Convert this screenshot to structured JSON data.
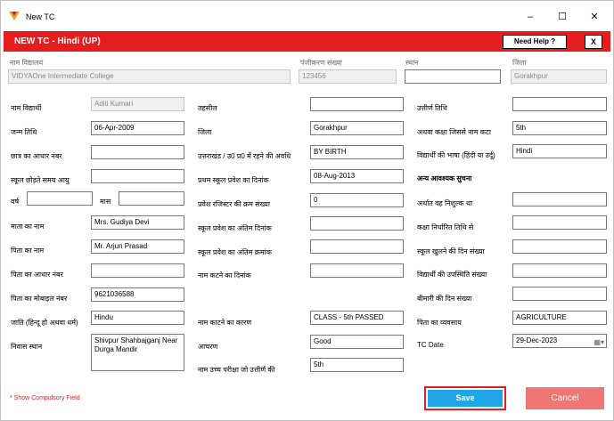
{
  "window": {
    "title": "New TC",
    "min": "–",
    "max": "☐",
    "close": "✕"
  },
  "header": {
    "title": "NEW TC - Hindi (UP)",
    "help": "Need Help ?",
    "close": "X"
  },
  "top": {
    "school_label": "नाम विद्यालय",
    "school_value": "VIDYAOne Intermediate College",
    "reg_label": "पंजीकरण संख्या",
    "reg_value": "123456",
    "place_label": "स्थान",
    "place_value": "",
    "district_label": "जिला",
    "district_value": "Gorakhpur"
  },
  "col1": {
    "student_name_label": "नाम विद्यार्थी",
    "student_name": "Aditi Kumari",
    "dob_label": "जन्म तिथि",
    "dob": "06-Apr-2009",
    "aadhar_label": "छात्र का आधार नंबर",
    "aadhar": "",
    "age_leaving_label": "स्कूल छोड़ते समय आयु",
    "age_leaving": "",
    "year_label": "वर्ष",
    "year": "",
    "month_label": "मास",
    "month": "",
    "mother_label": "माता का नाम",
    "mother": "Mrs. Gudiya Devi",
    "father_label": "पिता का नाम",
    "father": "Mr. Arjun Prasad",
    "father_aadhar_label": "पिता का आधार नंबर",
    "father_aadhar": "",
    "father_mobile_label": "पिता का मोबाइल नंबर",
    "father_mobile": "9621036588",
    "caste_label": "जाति (हिन्दू हो अथवा धर्म)",
    "caste": "Hindu",
    "residence_label": "निवास स्थान",
    "residence": "Shivpur Shahbajganj Near Durga Mandir"
  },
  "col2": {
    "tehsil_label": "तहसील",
    "tehsil": "",
    "district_label": "जिला",
    "district": "Gorakhpur",
    "uttarakhand_label": "उत्तराखंड / उ0 प्र0 में रहने की अवधि",
    "uttarakhand": "BY BIRTH",
    "first_admission_label": "प्रथम स्कूल प्रवेश का दिनांक",
    "first_admission": "08-Aug-2013",
    "admission_reg_label": "प्रवेश रजिस्टर की क्रम संख्या",
    "admission_reg": "0",
    "last_admission_date_label": "स्कूल प्रवेश का अंतिम दिनांक",
    "last_admission_date": "",
    "last_admission_no_label": "स्कूल प्रवेश का अंतिम क्रमांक",
    "last_admission_no": "",
    "removal_date_label": "नाम कटने का दिनांक",
    "removal_date": "",
    "removal_reason_label": "नाम काटने का कारण",
    "removal_reason": "CLASS - 5th PASSED",
    "conduct_label": "आचरण",
    "conduct": "Good",
    "higher_exam_label": "नाम उच्च परीक्षा जो उत्तीर्ण की",
    "higher_exam": "5th"
  },
  "col3": {
    "pass_date_label": "उत्तीर्ण तिथि",
    "pass_date": "",
    "class_label": "अथवा कक्षा जिससे नाम कटा",
    "class": "5th",
    "language_label": "विद्यार्थी की भाषा (हिंदी या उर्दू)",
    "language": "Hindi",
    "section_title": "अन्य आवश्यक सुचना",
    "free_label": "अर्थात वह निशुल्क था",
    "free": "",
    "class_date_label": "कक्षा निर्धारित तिथि से",
    "class_date": "",
    "open_days_label": "स्कूल खुलने की दिन संख्या",
    "open_days": "",
    "attendance_label": "विद्यार्थी की उपस्थिति संख्या",
    "attendance": "",
    "sick_days_label": "बीमारी की दिन संख्या",
    "sick_days": "",
    "father_occupation_label": "पिता का व्यवसाय",
    "father_occupation": "AGRICULTURE",
    "tc_date_label": "TC Date",
    "tc_date": "29-Dec-2023"
  },
  "footer": {
    "required": "* Show Compulsory Field",
    "save": "Save",
    "cancel": "Cancel"
  }
}
